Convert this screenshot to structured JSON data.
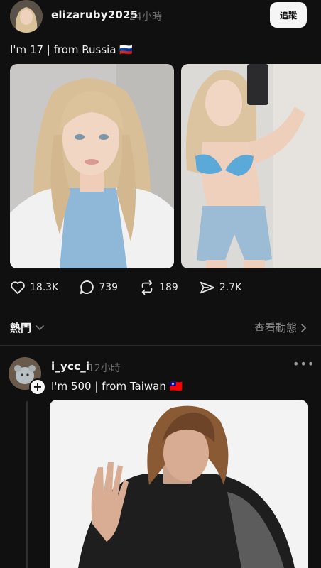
{
  "post1": {
    "username": "elizaruby2025",
    "time": "24小時",
    "follow_label": "追蹤",
    "caption": "I'm 17 | from Russia 🇷🇺",
    "stats": {
      "likes": "18.3K",
      "comments": "739",
      "reposts": "189",
      "shares": "2.7K"
    }
  },
  "feed_header": {
    "hot_label": "熱門",
    "view_activity_label": "查看動態"
  },
  "post2": {
    "username": "i_ycc_i",
    "time": "12小時",
    "caption": "I'm 500 | from Taiwan 🇹🇼"
  }
}
